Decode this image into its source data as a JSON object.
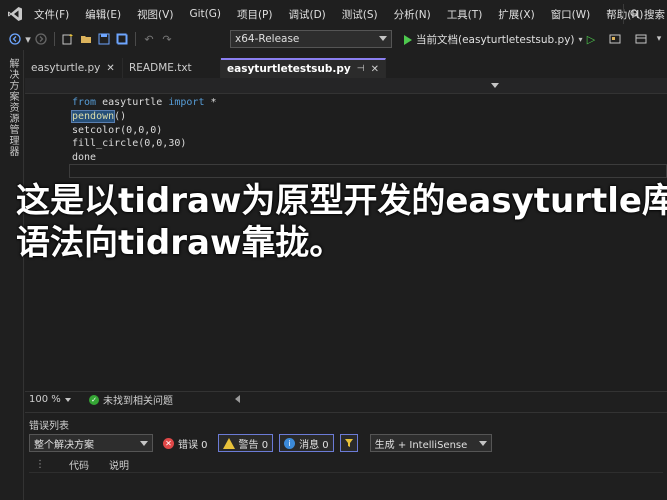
{
  "menu": {
    "items": [
      "文件(F)",
      "编辑(E)",
      "视图(V)",
      "Git(G)",
      "项目(P)",
      "调试(D)",
      "测试(S)",
      "分析(N)",
      "工具(T)",
      "扩展(X)",
      "窗口(W)",
      "帮助(H)"
    ],
    "search_label": "搜索"
  },
  "toolbar": {
    "configuration": "x64-Release",
    "run_target": "当前文档(easyturtletestsub.py)"
  },
  "side_panel": {
    "label": "解决方案资源管理器"
  },
  "tabs": [
    {
      "label": "easyturtle.py",
      "active": false,
      "close": "✕"
    },
    {
      "label": "README.txt",
      "active": false,
      "close": ""
    },
    {
      "label": "easyturtletestsub.py",
      "active": true,
      "pin": "⊣",
      "close": "✕"
    }
  ],
  "code": {
    "line1_kw1": "from",
    "line1_mid": " easyturtle ",
    "line1_kw2": "import",
    "line1_end": " *",
    "line2_fn": "pendown",
    "line2_end": "()",
    "line3": "setcolor(0,0,0)",
    "line4": "fill_circle(0,0,30)",
    "line5": "done"
  },
  "caption": {
    "line1": "这是以tidraw为原型开发的easyturtle库，",
    "line2": "语法向tidraw靠拢。"
  },
  "editor_status": {
    "zoom": "100 %",
    "issues": "未找到相关问题"
  },
  "error_list": {
    "title": "错误列表",
    "scope": "整个解决方案",
    "errors": "错误 0",
    "warnings": "警告 0",
    "messages": "消息 0",
    "build_filter": "生成 + IntelliSense",
    "col_code": "代码",
    "col_desc": "说明"
  },
  "colors": {
    "accent": "#8b7ff0",
    "keyword": "#569cd6",
    "function": "#dcdcaa",
    "run_green": "#4ec94e",
    "error_red": "#e04848",
    "warning_yellow": "#e8c23a",
    "info_blue": "#3c8ad8"
  }
}
